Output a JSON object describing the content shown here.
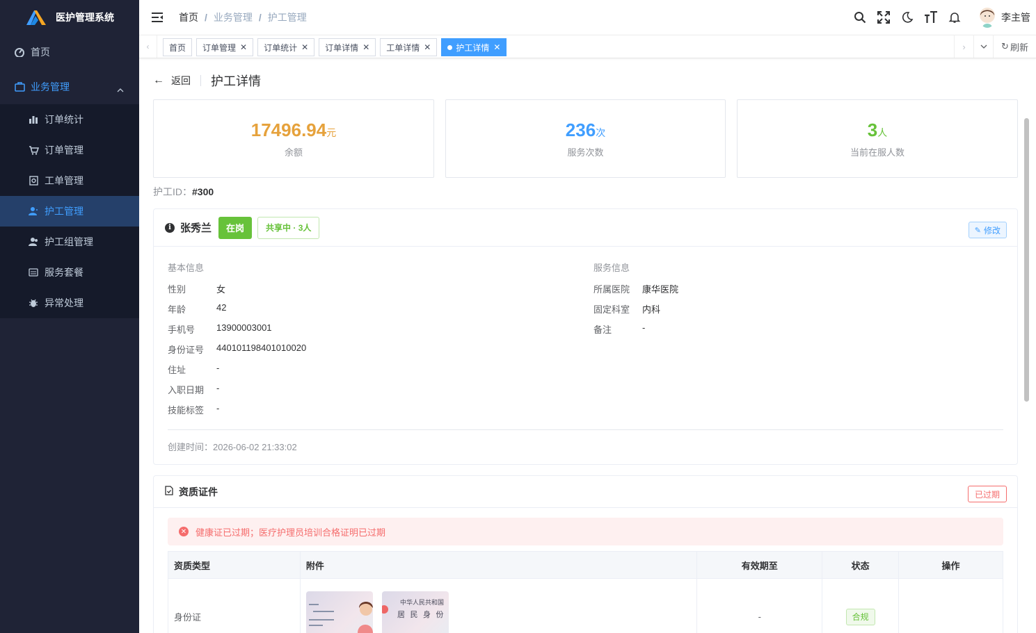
{
  "app": {
    "title": "医护管理系统"
  },
  "sidebar": {
    "home": "首页",
    "group": "业务管理",
    "items": [
      {
        "label": "订单统计",
        "icon": "bar-chart-icon"
      },
      {
        "label": "订单管理",
        "icon": "cart-icon"
      },
      {
        "label": "工单管理",
        "icon": "ticket-icon"
      },
      {
        "label": "护工管理",
        "icon": "user-icon",
        "active": true
      },
      {
        "label": "护工组管理",
        "icon": "users-icon"
      },
      {
        "label": "服务套餐",
        "icon": "package-icon"
      },
      {
        "label": "异常处理",
        "icon": "bug-icon"
      }
    ]
  },
  "header": {
    "breadcrumb": [
      "首页",
      "业务管理",
      "护工管理"
    ],
    "user": "李主管"
  },
  "tags": {
    "items": [
      "首页",
      "订单管理",
      "订单统计",
      "订单详情",
      "工单详情",
      "护工详情"
    ],
    "refresh": "刷新"
  },
  "page": {
    "back": "返回",
    "title": "护工详情",
    "stats": [
      {
        "value": "17496.94",
        "unit": "元",
        "label": "余额",
        "color": "#e6a23c"
      },
      {
        "value": "236",
        "unit": "次",
        "label": "服务次数",
        "color": "#409eff"
      },
      {
        "value": "3",
        "unit": "人",
        "label": "当前在服人数",
        "color": "#67c23a"
      }
    ],
    "nurse_id_label": "护工ID：",
    "nurse_id": "#300"
  },
  "profile": {
    "name": "张秀兰",
    "status": "在岗",
    "sharing": "共享中 · 3人",
    "edit": "修改",
    "basic_title": "基本信息",
    "basic": [
      {
        "k": "性别",
        "v": "女"
      },
      {
        "k": "年龄",
        "v": "42"
      },
      {
        "k": "手机号",
        "v": "13900003001"
      },
      {
        "k": "身份证号",
        "v": "440101198401010020"
      },
      {
        "k": "住址",
        "v": "-"
      },
      {
        "k": "入职日期",
        "v": "-"
      },
      {
        "k": "技能标签",
        "v": "-"
      }
    ],
    "service_title": "服务信息",
    "service": [
      {
        "k": "所属医院",
        "v": "康华医院"
      },
      {
        "k": "固定科室",
        "v": "内科"
      },
      {
        "k": "备注",
        "v": "-"
      }
    ],
    "created": "创建时间：2026-06-02 21:33:02"
  },
  "certs": {
    "title": "资质证件",
    "expired": "已过期",
    "alert": "健康证已过期；医疗护理员培训合格证明已过期",
    "columns": [
      "资质类型",
      "附件",
      "有效期至",
      "状态",
      "操作"
    ],
    "rows": [
      {
        "type": "身份证",
        "expiry": "-",
        "status": "合规",
        "id_front_text": "中华人民共和国",
        "id_back_text": "居 民 身 份"
      }
    ]
  }
}
